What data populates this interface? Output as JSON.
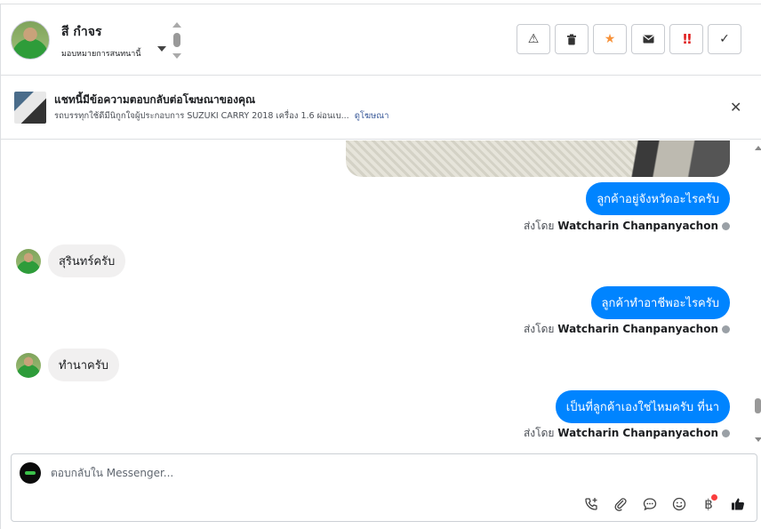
{
  "header": {
    "contact_name": "สี กำจร",
    "assign_label": "มอบหมายการสนทนานี้",
    "actions": [
      {
        "name": "report-spam-button",
        "icon": "warning-icon",
        "glyph": "⚠"
      },
      {
        "name": "delete-button",
        "icon": "trash-icon",
        "glyph": "🗑"
      },
      {
        "name": "star-button",
        "icon": "star-icon",
        "glyph": "★"
      },
      {
        "name": "mark-unread-button",
        "icon": "envelope-icon",
        "glyph": "✉"
      },
      {
        "name": "follow-up-button",
        "icon": "urgent-icon",
        "glyph": "!!"
      },
      {
        "name": "mark-done-button",
        "icon": "check-icon",
        "glyph": "✓"
      }
    ]
  },
  "ad_banner": {
    "title": "แชทนี้มีข้อความตอบกลับต่อโฆษณาของคุณ",
    "description": "รถบรรทุกใช้ดีมีนิกูกใจผู้ประกอบการ SUZUKI CARRY 2018 เครื่อง 1.6 ผ่อนเบ...",
    "link": "ดูโฆษณา",
    "close_glyph": "✕"
  },
  "messages": [
    {
      "direction": "out",
      "text": "ลูกค้าอยู่จังหวัดอะไรครับ"
    },
    {
      "direction": "in",
      "text": "สุรินทร์ครับ"
    },
    {
      "direction": "out",
      "text": "ลูกค้าทำอาชีพอะไรครับ"
    },
    {
      "direction": "in",
      "text": "ทำนาครับ"
    },
    {
      "direction": "out",
      "text": "เป็นที่ลูกค้าเองใช่ไหมครับ ที่นา"
    }
  ],
  "sent_by": {
    "prefix": "ส่งโดย",
    "agent": "Watcharin Chanpanyachon"
  },
  "composer": {
    "placeholder": "ตอบกลับใน Messenger..."
  },
  "colors": {
    "outgoing_bubble": "#0084ff",
    "incoming_bubble": "#f1f0f0",
    "star": "#f7923a",
    "urgent": "#e02020",
    "notification_dot": "#fa3e3e"
  }
}
